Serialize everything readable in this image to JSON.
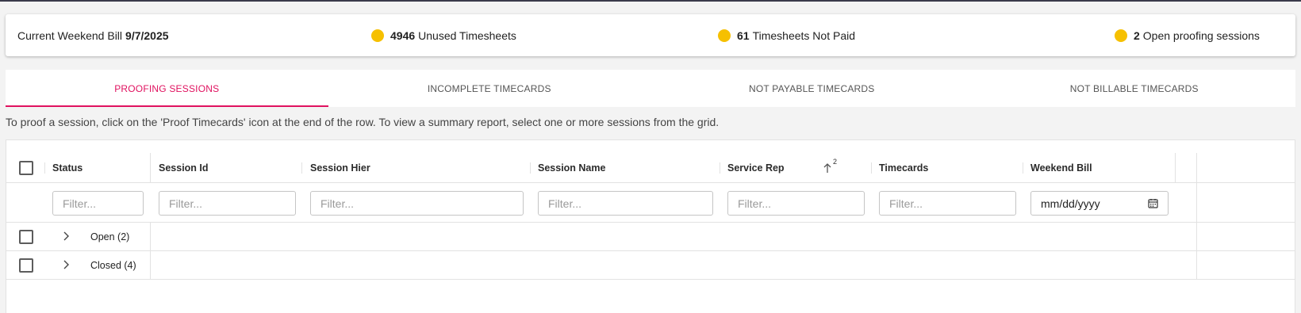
{
  "summary": {
    "current_bill_label": "Current Weekend Bill",
    "current_bill_date": "9/7/2025",
    "unused_count": "4946",
    "unused_label": "Unused Timesheets",
    "not_paid_count": "61",
    "not_paid_label": "Timesheets Not Paid",
    "open_count": "2",
    "open_label": "Open proofing sessions",
    "indicator_color": "#f6c000"
  },
  "tabs": [
    {
      "label": "PROOFING SESSIONS",
      "active": true
    },
    {
      "label": "INCOMPLETE TIMECARDS",
      "active": false
    },
    {
      "label": "NOT PAYABLE TIMECARDS",
      "active": false
    },
    {
      "label": "NOT BILLABLE TIMECARDS",
      "active": false
    }
  ],
  "accent_color": "#e0115f",
  "instructions": "To proof a session, click on the 'Proof Timecards' icon at the end of the row. To view a summary report, select one or more sessions from the grid.",
  "grid": {
    "columns": [
      {
        "label": "Status"
      },
      {
        "label": "Session Id"
      },
      {
        "label": "Session Hier"
      },
      {
        "label": "Session Name"
      },
      {
        "label": "Service Rep",
        "sort": "ascending",
        "sort_index": "2"
      },
      {
        "label": "Timecards"
      },
      {
        "label": "Weekend Bill"
      }
    ],
    "filter_placeholder": "Filter...",
    "date_placeholder": "mm/dd/yyyy",
    "groups": [
      {
        "label": "Open (2)"
      },
      {
        "label": "Closed (4)"
      }
    ]
  }
}
